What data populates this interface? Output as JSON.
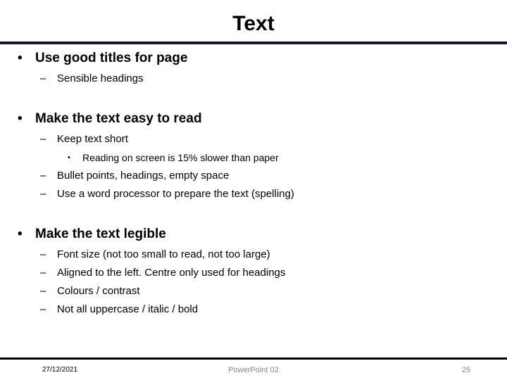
{
  "slide": {
    "title": "Text",
    "title_rule_color": "#16164a",
    "background_color": "#ffffff",
    "text_color": "#000000"
  },
  "markers": {
    "level1": "•",
    "level2": "–",
    "level3": "•"
  },
  "content": {
    "groups": [
      {
        "heading": "Use good titles for page",
        "lines": [
          {
            "level": 2,
            "text": "Sensible headings"
          }
        ]
      },
      {
        "heading": "Make the text easy to read",
        "lines": [
          {
            "level": 2,
            "text": "Keep text short"
          },
          {
            "level": 3,
            "text": "Reading on screen is 15% slower than paper"
          },
          {
            "level": 2,
            "text": "Bullet points, headings, empty space"
          },
          {
            "level": 2,
            "text": "Use a word processor to prepare the text (spelling)"
          }
        ]
      },
      {
        "heading": "Make the text legible",
        "lines": [
          {
            "level": 2,
            "text": "Font size (not too small to read, not too large)"
          },
          {
            "level": 2,
            "text": "Aligned to the left.  Centre only used for headings"
          },
          {
            "level": 2,
            "text": "Colours / contrast"
          },
          {
            "level": 2,
            "text": "Not all uppercase / italic / bold"
          }
        ]
      }
    ]
  },
  "footer": {
    "date": "27/12/2021",
    "center_text": "PowerPoint 02",
    "page_number": "25",
    "muted_color": "#8a8a8a",
    "rule_color": "#000000"
  }
}
